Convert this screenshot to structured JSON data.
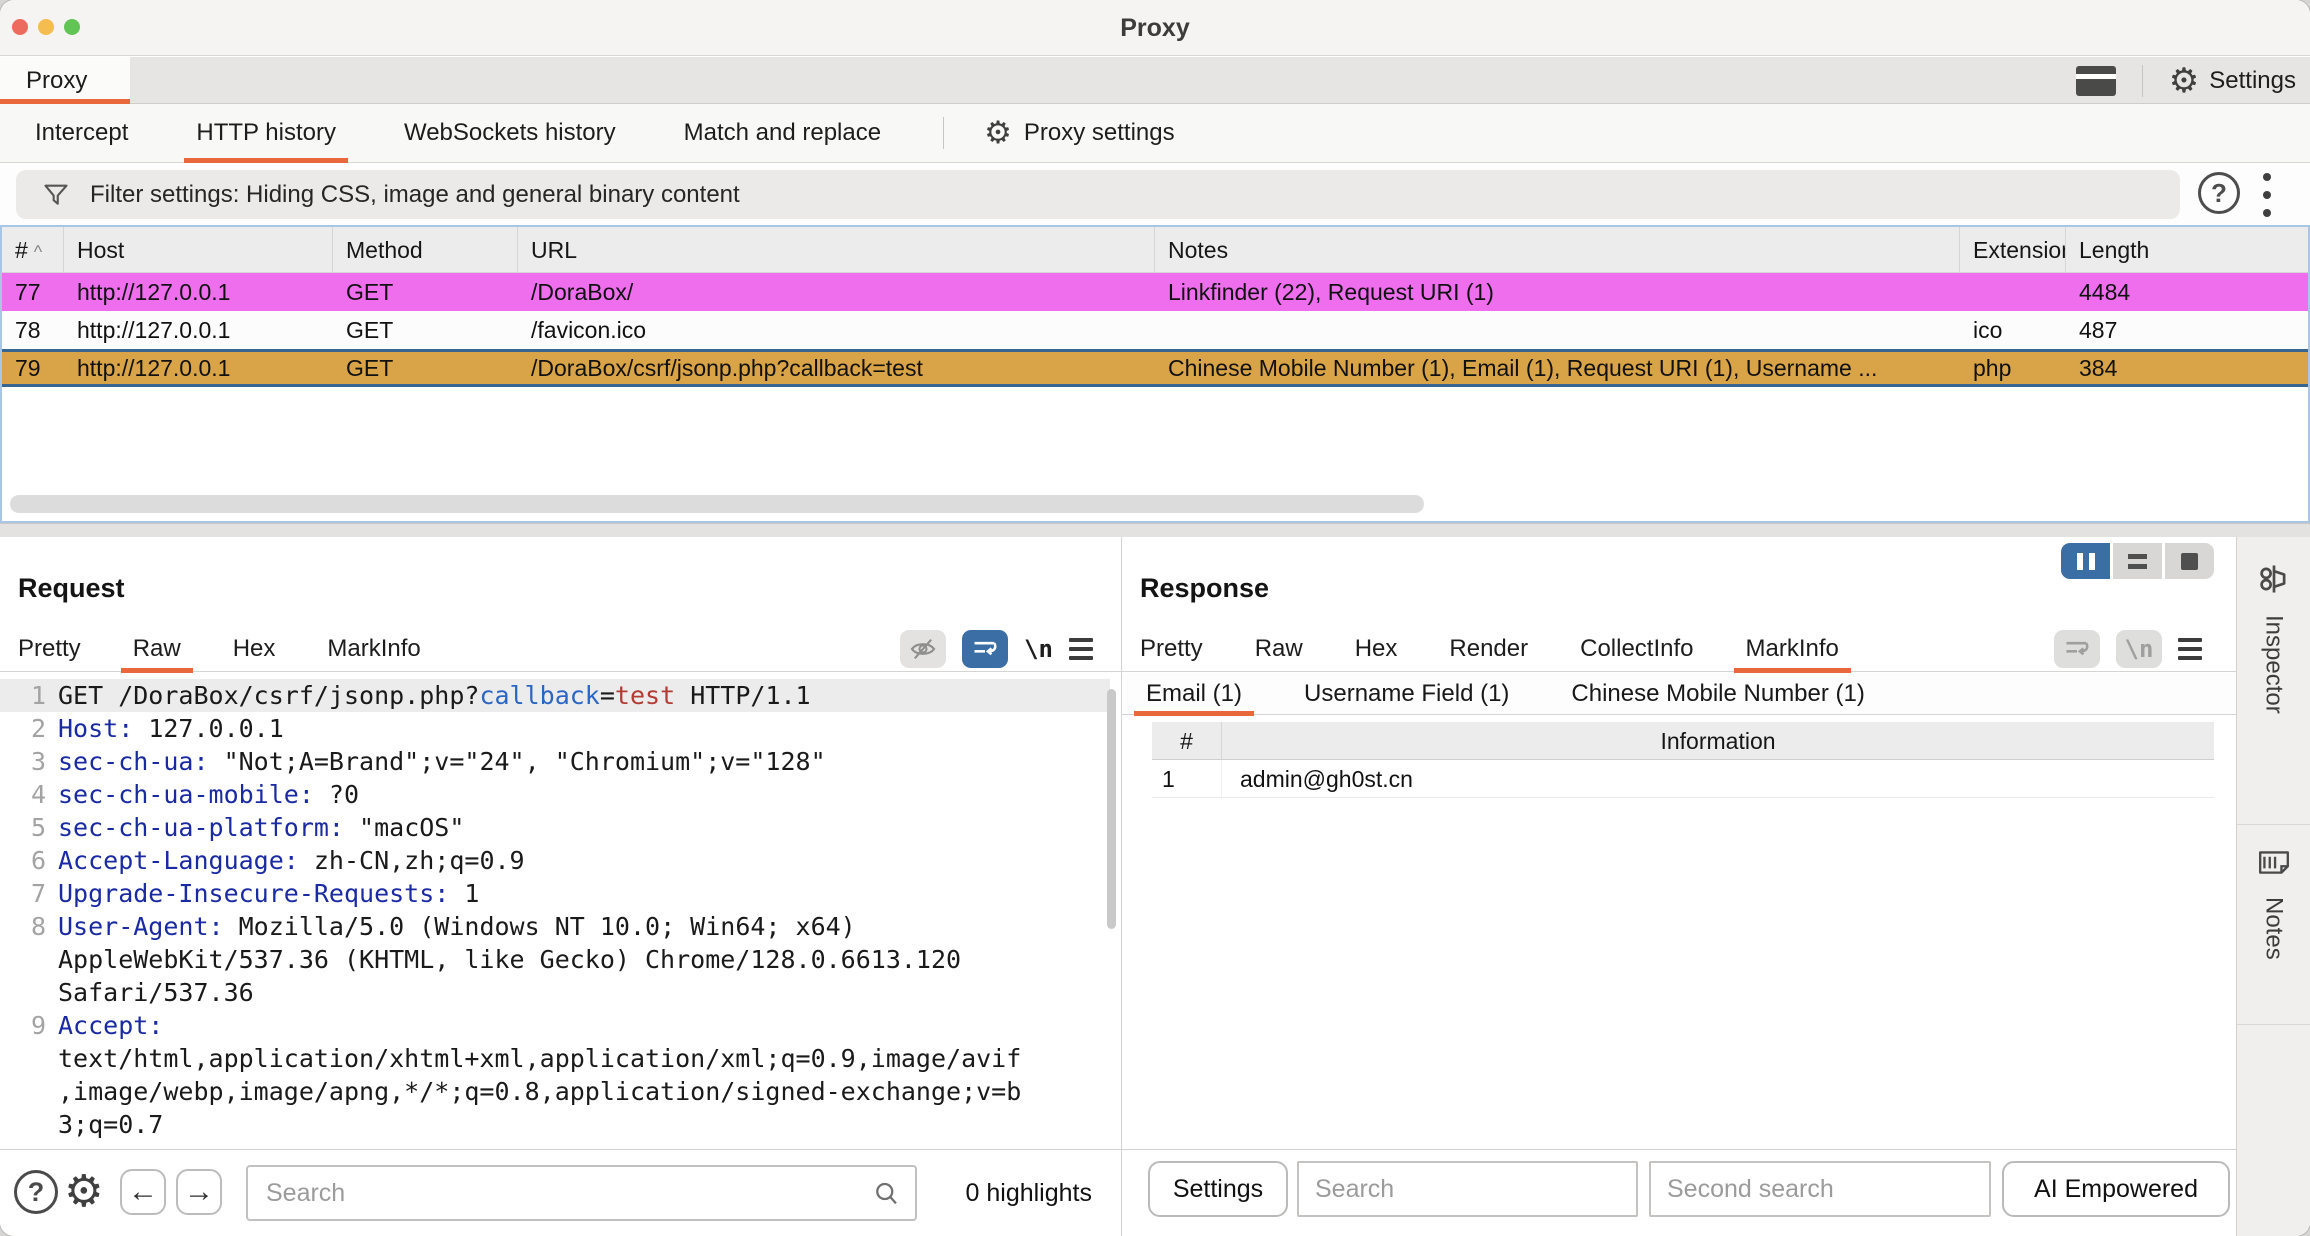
{
  "window": {
    "title": "Proxy"
  },
  "app_tabs": {
    "selected": "Proxy",
    "settings_label": "Settings"
  },
  "subtabs": {
    "items": [
      "Intercept",
      "HTTP history",
      "WebSockets history",
      "Match and replace"
    ],
    "selected": "HTTP history",
    "proxy_settings_label": "Proxy settings"
  },
  "filter_bar": {
    "text": "Filter settings: Hiding CSS, image and general binary content"
  },
  "history_table": {
    "columns": [
      "#",
      "Host",
      "Method",
      "URL",
      "Notes",
      "Extension",
      "Length"
    ],
    "rows": [
      {
        "id": "77",
        "host": "http://127.0.0.1",
        "method": "GET",
        "url": "/DoraBox/",
        "notes": "Linkfinder (22), Request URI (1)",
        "extension": "",
        "length": "4484",
        "highlight": "pink",
        "selected": false
      },
      {
        "id": "78",
        "host": "http://127.0.0.1",
        "method": "GET",
        "url": "/favicon.ico",
        "notes": "",
        "extension": "ico",
        "length": "487",
        "highlight": "plain",
        "selected": false
      },
      {
        "id": "79",
        "host": "http://127.0.0.1",
        "method": "GET",
        "url": "/DoraBox/csrf/jsonp.php?callback=test",
        "notes": "Chinese Mobile Number (1), Email (1), Request URI (1), Username ...",
        "extension": "php",
        "length": "384",
        "highlight": "gold",
        "selected": true
      }
    ]
  },
  "request": {
    "title": "Request",
    "tabs": [
      "Pretty",
      "Raw",
      "Hex",
      "MarkInfo"
    ],
    "selected_tab": "Raw",
    "newline_icon_label": "\\n",
    "lines": [
      {
        "n": "1",
        "hl": true,
        "parts": [
          [
            "p",
            "GET /DoraBox/csrf/jsonp.php?"
          ],
          [
            "q",
            "callback"
          ],
          [
            "p",
            "="
          ],
          [
            "v",
            "test"
          ],
          [
            "p",
            " HTTP/1.1"
          ]
        ]
      },
      {
        "n": "2",
        "hl": false,
        "parts": [
          [
            "n",
            "Host:"
          ],
          [
            "p",
            " 127.0.0.1"
          ]
        ]
      },
      {
        "n": "3",
        "hl": false,
        "parts": [
          [
            "n",
            "sec-ch-ua:"
          ],
          [
            "p",
            " \"Not;A=Brand\";v=\"24\", \"Chromium\";v=\"128\""
          ]
        ]
      },
      {
        "n": "4",
        "hl": false,
        "parts": [
          [
            "n",
            "sec-ch-ua-mobile:"
          ],
          [
            "p",
            " ?0"
          ]
        ]
      },
      {
        "n": "5",
        "hl": false,
        "parts": [
          [
            "n",
            "sec-ch-ua-platform:"
          ],
          [
            "p",
            " \"macOS\""
          ]
        ]
      },
      {
        "n": "6",
        "hl": false,
        "parts": [
          [
            "n",
            "Accept-Language:"
          ],
          [
            "p",
            " zh-CN,zh;q=0.9"
          ]
        ]
      },
      {
        "n": "7",
        "hl": false,
        "parts": [
          [
            "n",
            "Upgrade-Insecure-Requests:"
          ],
          [
            "p",
            " 1"
          ]
        ]
      },
      {
        "n": "8",
        "hl": false,
        "parts": [
          [
            "n",
            "User-Agent:"
          ],
          [
            "p",
            " Mozilla/5.0 (Windows NT 10.0; Win64; x64)"
          ]
        ]
      },
      {
        "n": "",
        "hl": false,
        "parts": [
          [
            "p",
            "AppleWebKit/537.36 (KHTML, like Gecko) Chrome/128.0.6613.120"
          ]
        ]
      },
      {
        "n": "",
        "hl": false,
        "parts": [
          [
            "p",
            "Safari/537.36"
          ]
        ]
      },
      {
        "n": "9",
        "hl": false,
        "parts": [
          [
            "n",
            "Accept:"
          ]
        ]
      },
      {
        "n": "",
        "hl": false,
        "parts": [
          [
            "p",
            "text/html,application/xhtml+xml,application/xml;q=0.9,image/avif"
          ]
        ]
      },
      {
        "n": "",
        "hl": false,
        "parts": [
          [
            "p",
            ",image/webp,image/apng,*/*;q=0.8,application/signed-exchange;v=b"
          ]
        ]
      },
      {
        "n": "",
        "hl": false,
        "parts": [
          [
            "p",
            "3;q=0.7"
          ]
        ]
      }
    ],
    "footer": {
      "search_placeholder": "Search",
      "highlights_label": "0 highlights"
    }
  },
  "response": {
    "title": "Response",
    "tabs": [
      "Pretty",
      "Raw",
      "Hex",
      "Render",
      "CollectInfo",
      "MarkInfo"
    ],
    "selected_tab": "MarkInfo",
    "subtabs": [
      "Email (1)",
      "Username Field (1)",
      "Chinese Mobile Number (1)"
    ],
    "selected_subtab": "Email (1)",
    "table": {
      "columns": [
        "#",
        "Information"
      ],
      "rows": [
        {
          "num": "1",
          "info": "admin@gh0st.cn"
        }
      ]
    },
    "footer": {
      "settings_label": "Settings",
      "search_placeholder": "Search",
      "second_search_placeholder": "Second search",
      "ai_label": "AI Empowered"
    }
  },
  "sidebar": {
    "tabs": [
      {
        "label": "Inspector"
      },
      {
        "label": "Notes"
      }
    ]
  },
  "colors": {
    "accent": "#e8683c",
    "row_pink": "#ee6eee",
    "row_gold": "#d9a347",
    "sel_blue": "#39668f",
    "seg_blue": "#3a6ea5",
    "hdr_name": "#1a2aa2",
    "param_blue": "#2b66c4",
    "val_red": "#b23c33"
  }
}
